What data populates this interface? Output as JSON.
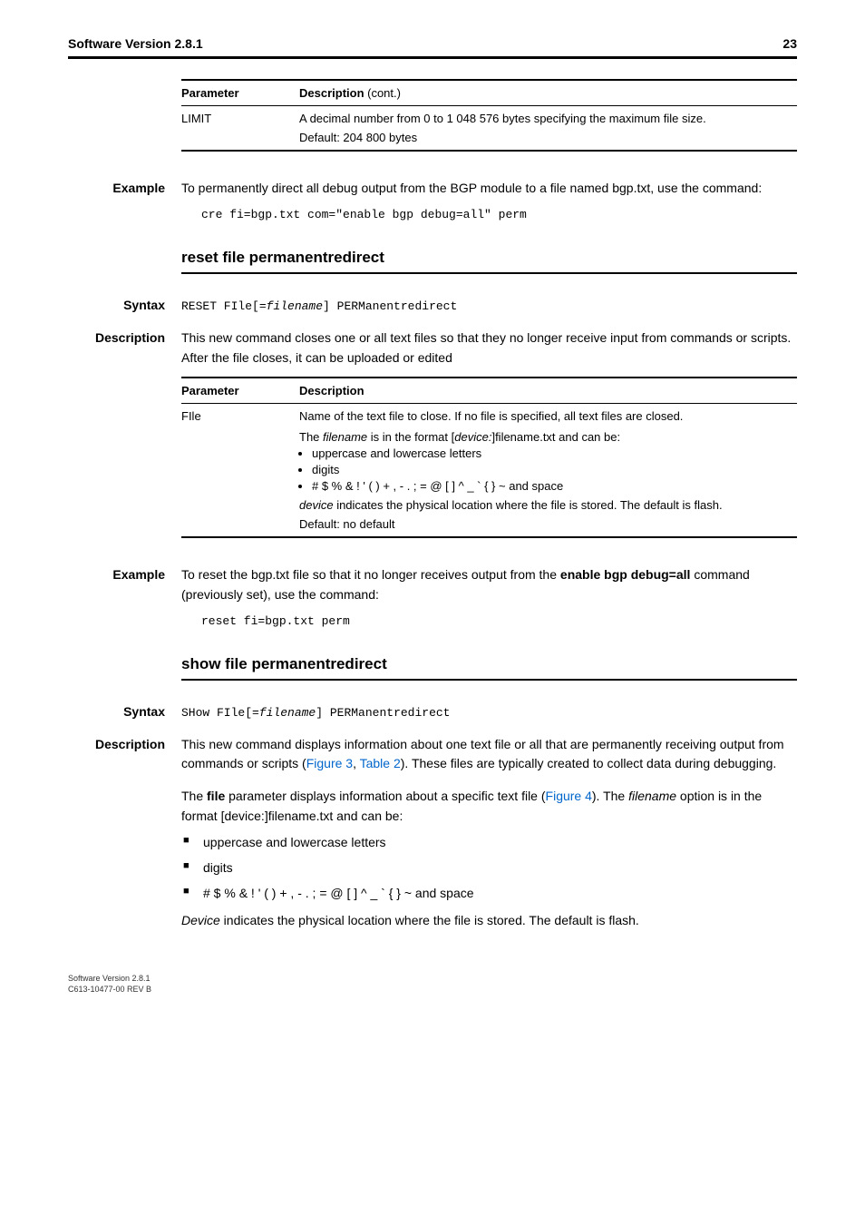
{
  "header": {
    "left": "Software Version 2.8.1",
    "right": "23"
  },
  "table1": {
    "h1": "Parameter",
    "h2_a": "Description",
    "h2_b": " (cont.)",
    "r1c1": "LIMIT",
    "r1c2a": "A decimal number from 0 to 1 048 576 bytes specifying the maximum file size.",
    "r1c2b": "Default: 204 800 bytes"
  },
  "ex1": {
    "label": "Example",
    "text1": "To permanently direct all debug output from the BGP module to a file named bgp.txt, use the command:",
    "code": "cre fi=bgp.txt com=\"enable bgp debug=all\" perm"
  },
  "sect1": {
    "title": "reset file permanentredirect",
    "syntax_label": "Syntax",
    "syntax_code_a": "RESET FIle[=",
    "syntax_code_i": "filename",
    "syntax_code_b": "] PERManentredirect",
    "desc_label": "Description",
    "desc_text": "This new command closes one or all text files so that they no longer receive input from commands or scripts. After the file closes, it can be uploaded or edited"
  },
  "table2": {
    "h1": "Parameter",
    "h2": "Description",
    "r1c1": "FIle",
    "r1a": "Name of the text file to close. If no file is specified, all text files are closed.",
    "r1b_a": "The ",
    "r1b_b": "filename",
    "r1b_c": " is in the format [",
    "r1b_d": "device:",
    "r1b_e": "]filename.txt and can be:",
    "li1": "uppercase and lowercase letters",
    "li2": "digits",
    "li3": "# $ % & ! ' ( ) + , - . ; = @ [ ] ^ _ ` { } ~ and space",
    "r1c_a": "device",
    "r1c_b": " indicates the physical location where the file is stored. The default is flash.",
    "r1d": "Default: no default"
  },
  "ex2": {
    "label": "Example",
    "t1": "To reset the bgp.txt file so that it no longer receives output from the ",
    "t2": "enable bgp debug=all",
    "t3": " command (previously set), use the command:",
    "code": "reset fi=bgp.txt perm"
  },
  "sect2": {
    "title": "show file permanentredirect",
    "syntax_label": "Syntax",
    "syntax_code_a": "SHow FIle[=",
    "syntax_code_i": "filename",
    "syntax_code_b": "] PERManentredirect",
    "desc_label": "Description",
    "d1a": "This new command displays information about one text file or all that are permanently receiving output from commands or scripts (",
    "d1b": "Figure 3",
    "d1c": ", ",
    "d1d": "Table 2",
    "d1e": "). These files are typically created to collect data during debugging.",
    "d2a": "The ",
    "d2b": "file",
    "d2c": " parameter displays information about a specific text file (",
    "d2d": "Figure 4",
    "d2e": "). The ",
    "d2f": "filename",
    "d2g": " option is in the format [device:]filename.txt and can be:",
    "li1": "uppercase and lowercase letters",
    "li2": "digits",
    "li3": "# $ % & ! ' ( ) + , - . ; = @ [ ] ^ _ ` { } ~ and space",
    "d3a": "Device",
    "d3b": " indicates the physical location where the file is stored. The default is flash."
  },
  "footer": {
    "l1": "Software Version 2.8.1",
    "l2": "C613-10477-00 REV B"
  }
}
